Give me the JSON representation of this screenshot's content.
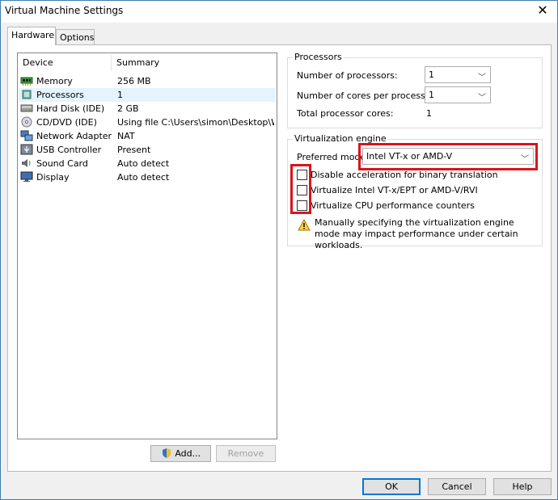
{
  "window": {
    "title": "Virtual Machine Settings"
  },
  "tabs": [
    {
      "label": "Hardware",
      "active": true
    },
    {
      "label": "Options",
      "active": false
    }
  ],
  "device_list": {
    "columns": [
      "Device",
      "Summary"
    ],
    "rows": [
      {
        "icon": "memory-icon",
        "device": "Memory",
        "summary": "256 MB"
      },
      {
        "icon": "processor-icon",
        "device": "Processors",
        "summary": "1",
        "selected": true
      },
      {
        "icon": "hard-disk-icon",
        "device": "Hard Disk (IDE)",
        "summary": "2 GB"
      },
      {
        "icon": "cd-dvd-icon",
        "device": "CD/DVD (IDE)",
        "summary": "Using file C:\\Users\\simon\\Desktop\\W..."
      },
      {
        "icon": "network-adapter-icon",
        "device": "Network Adapter",
        "summary": "NAT"
      },
      {
        "icon": "usb-icon",
        "device": "USB Controller",
        "summary": "Present"
      },
      {
        "icon": "sound-card-icon",
        "device": "Sound Card",
        "summary": "Auto detect"
      },
      {
        "icon": "display-icon",
        "device": "Display",
        "summary": "Auto detect"
      }
    ]
  },
  "list_buttons": {
    "add": "Add...",
    "remove": "Remove"
  },
  "processors": {
    "title": "Processors",
    "num_processors_label": "Number of processors:",
    "num_processors_value": "1",
    "cores_label": "Number of cores per processor:",
    "cores_value": "1",
    "total_label": "Total processor cores:",
    "total_value": "1"
  },
  "virtualization": {
    "title": "Virtualization engine",
    "mode_label": "Preferred mode",
    "mode_value": "Intel VT-x or AMD-V",
    "options": [
      {
        "label": "Disable acceleration for binary translation",
        "checked": false
      },
      {
        "label": "Virtualize Intel VT-x/EPT or AMD-V/RVI",
        "checked": false
      },
      {
        "label": "Virtualize CPU performance counters",
        "checked": false
      }
    ],
    "warning": "Manually specifying the virtualization engine mode may impact performance under certain workloads."
  },
  "dialog_buttons": {
    "ok": "OK",
    "cancel": "Cancel",
    "help": "Help"
  },
  "colors": {
    "highlight": "#d9141c",
    "selection": "#e5f3ff",
    "accent": "#0078d7"
  }
}
